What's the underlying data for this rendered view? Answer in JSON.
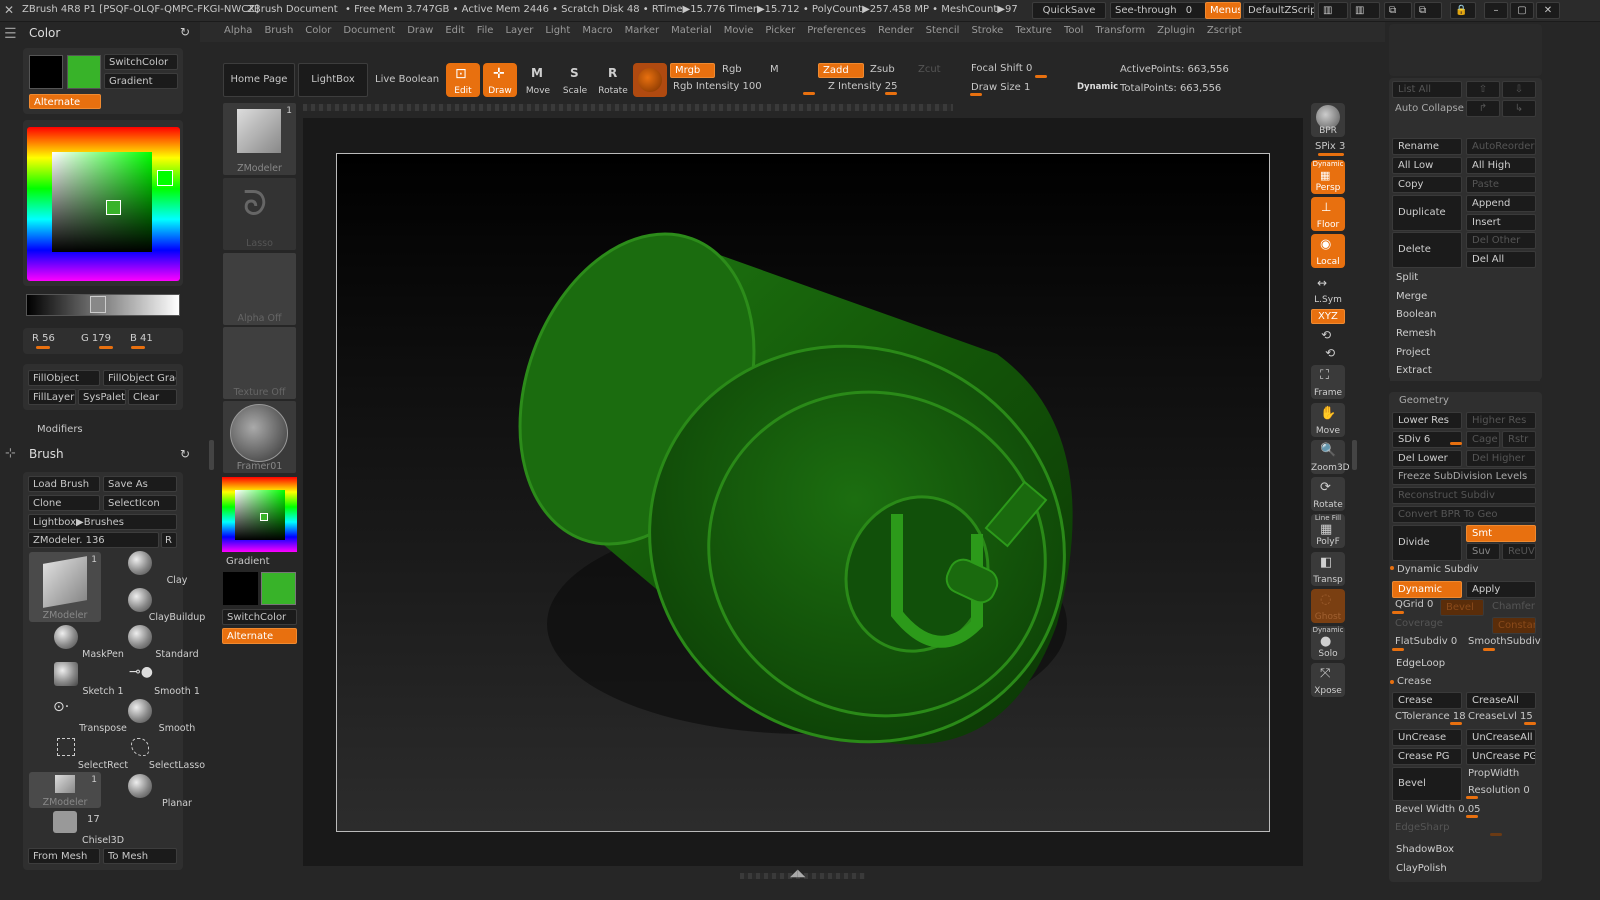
{
  "title": {
    "app": "ZBrush 4R8 P1 [PSQF-OLQF-QMPC-FKGI-NWCX]",
    "doc": "ZBrush Document",
    "stats": "• Free Mem 3.747GB • Active Mem 2446 • Scratch Disk 48 • RTime▶15.776 Timer▶15.712 • PolyCount▶257.458 MP • MeshCount▶97",
    "quicksave": "QuickSave",
    "seethrough": "See-through",
    "seethrough_val": "0",
    "menus": "Menus",
    "defaultzscript": "DefaultZScript"
  },
  "menubar": [
    "Alpha",
    "Brush",
    "Color",
    "Document",
    "Draw",
    "Edit",
    "File",
    "Layer",
    "Light",
    "Macro",
    "Marker",
    "Material",
    "Movie",
    "Picker",
    "Preferences",
    "Render",
    "Stencil",
    "Stroke",
    "Texture",
    "Tool",
    "Transform",
    "Zplugin",
    "Zscript"
  ],
  "color_panel": {
    "title": "Color",
    "switchcolor": "SwitchColor",
    "gradient": "Gradient",
    "alternate": "Alternate",
    "r": "R 56",
    "g": "G 179",
    "b": "B 41",
    "fillobject": "FillObject",
    "fillobject_grad": "FillObject Grad",
    "filllayer": "FillLayer",
    "syspalette": "SysPalett",
    "clear": "Clear",
    "modifiers": "Modifiers",
    "main_color": "#38b329"
  },
  "brush_panel": {
    "title": "Brush",
    "load": "Load Brush",
    "save": "Save As",
    "clone": "Clone",
    "selecticon": "SelectIcon",
    "lightbox": "Lightbox▶Brushes",
    "current": "ZModeler. 136",
    "r": "R",
    "brushes": [
      "ZModeler",
      "Clay",
      "ClayBuildup",
      "MaskPen",
      "Standard",
      "Sketch 1",
      "Smooth 1",
      "Transpose",
      "Smooth",
      "SelectRect",
      "SelectLasso",
      "ZModeler",
      "Planar",
      "Chisel3D"
    ],
    "count1": "1",
    "count2": "1",
    "count17": "17",
    "frommesh": "From Mesh",
    "tomesh": "To Mesh"
  },
  "shelf": {
    "zmodeler": "ZModeler",
    "lasso": "Lasso",
    "alphaoff": "Alpha Off",
    "textureoff": "Texture Off",
    "framer": "Framer01",
    "gradient": "Gradient",
    "switchcolor": "SwitchColor",
    "alternate": "Alternate",
    "count": "1"
  },
  "toolbar": {
    "homepage": "Home Page",
    "lightbox": "LightBox",
    "liveboolean": "Live Boolean",
    "edit": "Edit",
    "draw": "Draw",
    "move": "Move",
    "scale": "Scale",
    "rotate": "Rotate",
    "mrgb": "Mrgb",
    "rgb": "Rgb",
    "m": "M",
    "zadd": "Zadd",
    "zsub": "Zsub",
    "zcut": "Zcut",
    "rgbint": "Rgb Intensity 100",
    "zint": "Z Intensity 25",
    "focal": "Focal Shift 0",
    "drawsize": "Draw Size 1",
    "dynamic": "Dynamic",
    "active": "ActivePoints: 663,556",
    "total": "TotalPoints: 663,556"
  },
  "rightshelf": {
    "bpr": "BPR",
    "spix": "SPix 3",
    "persp": "Persp",
    "dynamic": "Dynamic",
    "floor": "Floor",
    "local": "Local",
    "lsym": "L.Sym",
    "xyz": "XYZ",
    "frame": "Frame",
    "move": "Move",
    "zoom": "Zoom3D",
    "rotate": "Rotate",
    "linefill": "Line Fill",
    "polyf": "PolyF",
    "transp": "Transp",
    "ghost": "Ghost",
    "solo": "Solo",
    "xpose": "Xpose"
  },
  "subtool": {
    "listall": "List All",
    "autocollapse": "Auto Collapse",
    "rename": "Rename",
    "autoreorder": "AutoReorder",
    "alllow": "All Low",
    "allhigh": "All High",
    "copy": "Copy",
    "paste": "Paste",
    "duplicate": "Duplicate",
    "append": "Append",
    "insert": "Insert",
    "delete": "Delete",
    "delother": "Del Other",
    "delall": "Del All",
    "rows": [
      "Split",
      "Merge",
      "Boolean",
      "Remesh",
      "Project",
      "Extract"
    ]
  },
  "geometry": {
    "title": "Geometry",
    "lowerres": "Lower Res",
    "higherres": "Higher Res",
    "sdiv": "SDiv 6",
    "cage": "Cage",
    "rstr": "Rstr",
    "dellower": "Del Lower",
    "delhigher": "Del Higher",
    "freeze": "Freeze SubDivision Levels",
    "reconstruct": "Reconstruct Subdiv",
    "convert": "Convert BPR To Geo",
    "divide": "Divide",
    "smt": "Smt",
    "suv": "Suv",
    "reuv": "ReUV",
    "dynsubdiv": "Dynamic Subdiv",
    "dynamic": "Dynamic",
    "apply": "Apply",
    "qgrid": "QGrid 0",
    "bevel": "Bevel",
    "chamfer": "Chamfer",
    "coverage": "Coverage",
    "constant": "Constant",
    "flatsubdiv": "FlatSubdiv 0",
    "smoothsubdiv": "SmoothSubdiv",
    "edgeloop": "EdgeLoop",
    "crease_title": "Crease",
    "crease": "Crease",
    "creaseall": "CreaseAll",
    "ctol": "CTolerance 18",
    "creaselvl": "CreaseLvl 15",
    "uncrease": "UnCrease",
    "uncreaseall": "UnCreaseAll",
    "creasepg": "Crease PG",
    "uncreasepg": "UnCrease PG",
    "bevel2": "Bevel",
    "propwidth": "PropWidth",
    "resolution": "Resolution 0",
    "bevelwidth": "Bevel Width 0.05",
    "edgesharp": "EdgeSharp",
    "shadowbox": "ShadowBox",
    "claypolish": "ClayPolish"
  }
}
